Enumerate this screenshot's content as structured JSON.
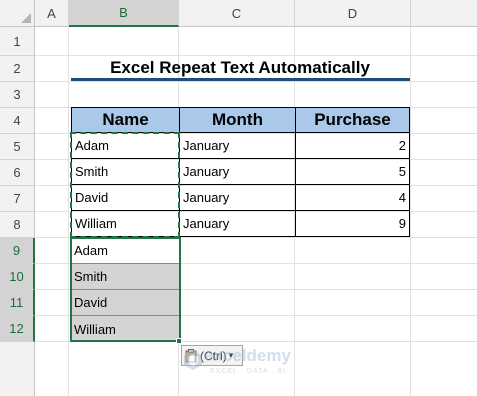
{
  "sheet": {
    "columns": [
      "A",
      "B",
      "C",
      "D"
    ],
    "rows": [
      "1",
      "2",
      "3",
      "4",
      "5",
      "6",
      "7",
      "8",
      "9",
      "10",
      "11",
      "12"
    ],
    "title": "Excel Repeat Text Automatically",
    "headers": [
      "Name",
      "Month",
      "Purchase"
    ],
    "data": [
      {
        "name": "Adam",
        "month": "January",
        "purchase": "2"
      },
      {
        "name": "Smith",
        "month": "January",
        "purchase": "5"
      },
      {
        "name": "David",
        "month": "January",
        "purchase": "4"
      },
      {
        "name": "William",
        "month": "January",
        "purchase": "9"
      }
    ],
    "pasted": [
      "Adam",
      "Smith",
      "David",
      "William"
    ],
    "paste_options": "(Ctrl)",
    "paste_arrow": "▾"
  },
  "watermark": {
    "name": "exceldemy",
    "tagline": "EXCEL · DATA · BI"
  },
  "colors": {
    "accent": "#217346",
    "title_underline": "#1f4e79",
    "header_fill": "#a9c8ea"
  }
}
